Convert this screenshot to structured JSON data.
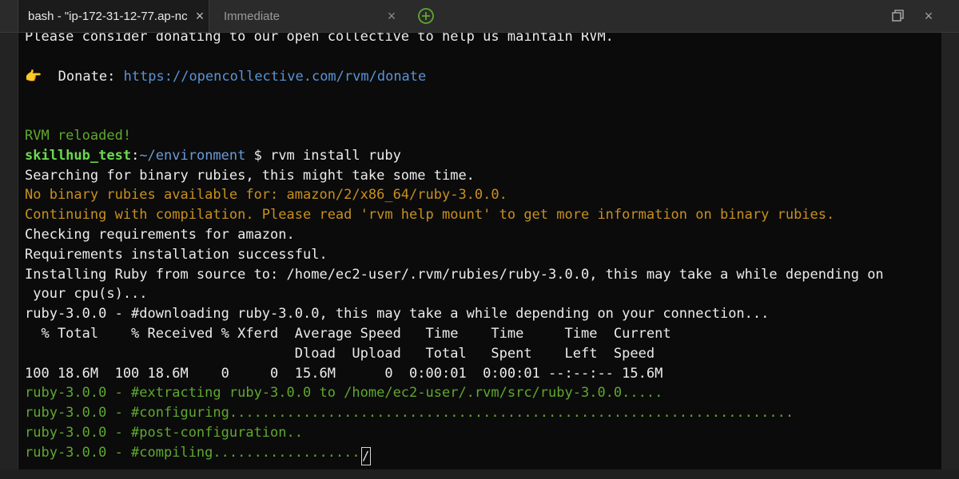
{
  "tabs": [
    {
      "label": "bash - \"ip-172-31-12-77.ap-nc",
      "close": "×"
    },
    {
      "label": "Immediate",
      "close": "×"
    }
  ],
  "window_controls": {
    "restore_icon": "restore-window-icon",
    "close": "×",
    "add_icon": "plus-circle-icon"
  },
  "colors": {
    "accent_green": "#5fa82e",
    "warning_orange": "#c8901e",
    "link_blue": "#5a93d6"
  },
  "terminal": {
    "line_top": "Please consider donating to our open collective to help us maintain RVM.",
    "donate_label": "Donate:",
    "donate_url": "https://opencollective.com/rvm/donate",
    "reloaded": "RVM reloaded!",
    "prompt_user": "skillhub_test",
    "prompt_colon": ":",
    "prompt_path": "~/environment",
    "prompt_cmd": " $ rvm install ruby",
    "l_search": "Searching for binary rubies, this might take some time.",
    "l_nobinary": "No binary rubies available for: amazon/2/x86_64/ruby-3.0.0.",
    "l_continue": "Continuing with compilation. Please read 'rvm help mount' to get more information on binary rubies.",
    "l_checking": "Checking requirements for amazon.",
    "l_reqok": "Requirements installation successful.",
    "l_install1": "Installing Ruby from source to: /home/ec2-user/.rvm/rubies/ruby-3.0.0, this may take a while depending on",
    "l_install2": " your cpu(s)...",
    "l_download": "ruby-3.0.0 - #downloading ruby-3.0.0, this may take a while depending on your connection...",
    "l_hdr1": "  % Total    % Received % Xferd  Average Speed   Time    Time     Time  Current",
    "l_hdr2": "                                 Dload  Upload   Total   Spent    Left  Speed",
    "l_stats": "100 18.6M  100 18.6M    0     0  15.6M      0  0:00:01  0:00:01 --:--:-- 15.6M",
    "l_extract": "ruby-3.0.0 - #extracting ruby-3.0.0 to /home/ec2-user/.rvm/src/ruby-3.0.0.....",
    "l_config": "ruby-3.0.0 - #configuring.....................................................................",
    "l_postconf": "ruby-3.0.0 - #post-configuration..",
    "l_compile": "ruby-3.0.0 - #compiling..................",
    "cursor_char": "/"
  }
}
